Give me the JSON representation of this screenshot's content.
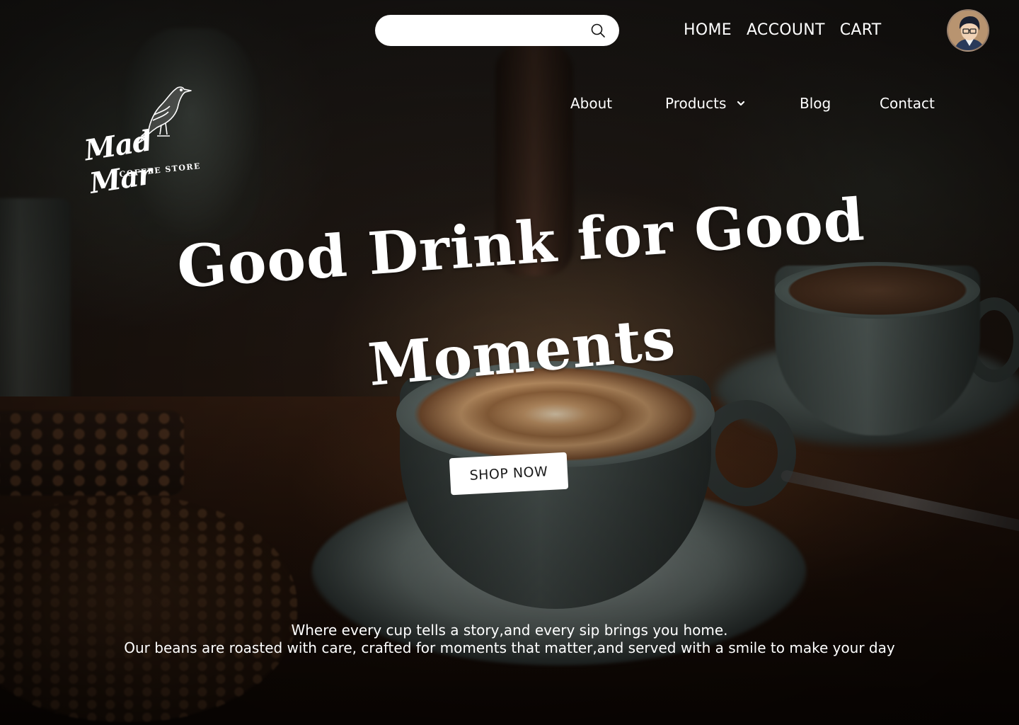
{
  "search": {
    "placeholder": "",
    "value": "",
    "icon": "search-icon"
  },
  "top_nav": {
    "items": [
      {
        "label": "HOME"
      },
      {
        "label": "ACCOUNT"
      },
      {
        "label": "CART"
      }
    ]
  },
  "avatar": {
    "icon": "user-avatar"
  },
  "main_nav": {
    "about": "About",
    "products": "Products",
    "products_icon": "chevron-down-icon",
    "blog": "Blog",
    "contact": "Contact"
  },
  "logo": {
    "name": "Mad Mar",
    "subtitle": "COFFEE STORE",
    "icon": "crow-icon"
  },
  "hero": {
    "title_line1": "Good Drink for Good",
    "title_line2": "Moments",
    "cta_label": "SHOP NOW"
  },
  "tagline": {
    "line1": "Where every cup tells a story,and every sip brings you home.",
    "line2": "Our beans are roasted with care, crafted for moments that matter,and served with a smile to make your day"
  },
  "colors": {
    "text": "#ffffff",
    "button_bg": "#ffffff",
    "button_text": "#1a1a1a",
    "background_dark": "#1a130e"
  }
}
